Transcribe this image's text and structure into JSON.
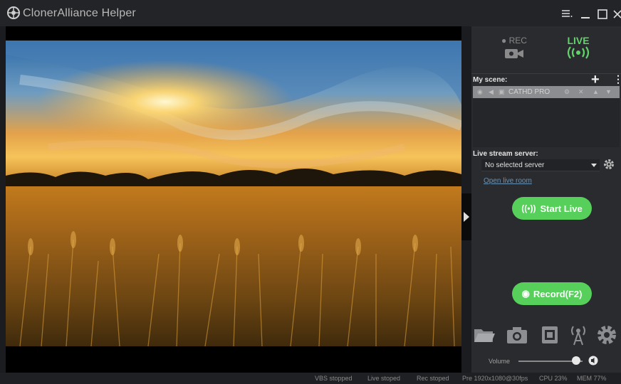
{
  "window": {
    "title": "ClonerAlliance Helper"
  },
  "mode": {
    "rec_label": "REC",
    "live_label": "LIVE"
  },
  "scene": {
    "label": "My scene:",
    "items": [
      {
        "name": "CATHD PRO"
      }
    ]
  },
  "live": {
    "server_label": "Live stream server:",
    "server_value": "No selected server",
    "open_room": "Open live room",
    "start_label": "Start Live"
  },
  "record": {
    "label": "Record(F2)"
  },
  "volume": {
    "label": "Volume",
    "level": 0.9
  },
  "status": {
    "vbs": "VBS stopped",
    "live": "Live stoped",
    "rec": "Rec stoped",
    "pre": "Pre 1920x1080@30fps",
    "cpu": "CPU 23%",
    "mem": "MEM 77%"
  },
  "colors": {
    "accent_green": "#56cf5b",
    "live_green": "#62d36a"
  }
}
